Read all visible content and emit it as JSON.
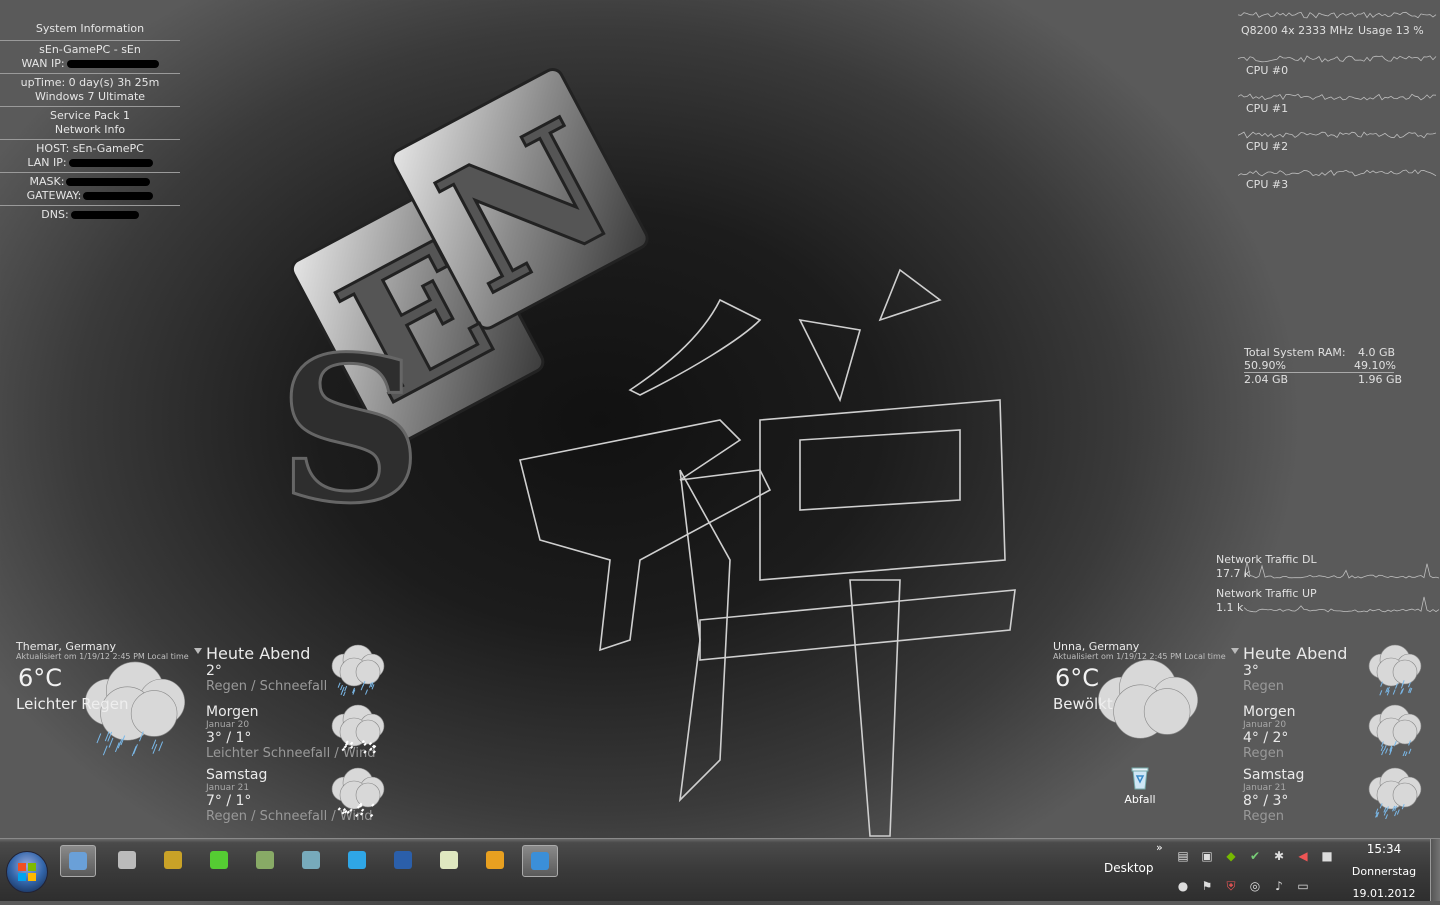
{
  "sysinfo": {
    "title": "System Information",
    "computer": "sEn-GamePC - sEn",
    "wan_label": "WAN IP:",
    "uptime": "upTime: 0 day(s) 3h 25m",
    "os": "Windows 7 Ultimate",
    "sp": "Service Pack 1",
    "netinfo": "Network Info",
    "host": "HOST: sEn-GamePC",
    "lan_label": "LAN IP:",
    "mask_label": "MASK:",
    "gateway_label": "GATEWAY:",
    "dns_label": "DNS:"
  },
  "cpu": {
    "model": "Q8200 4x 2333 MHz",
    "usage": "Usage 13 %",
    "cores": [
      "CPU #0",
      "CPU #1",
      "CPU #2",
      "CPU #3"
    ]
  },
  "ram": {
    "label": "Total System RAM:",
    "total": "4.0 GB",
    "used_pct": "50.90%",
    "free_pct": "49.10%",
    "used": "2.04 GB",
    "free": "1.96 GB"
  },
  "net": {
    "dl_label": "Network Traffic DL",
    "dl_value": "17.7 k",
    "up_label": "Network Traffic UP",
    "up_value": "1.1 k"
  },
  "weather_left": {
    "location": "Themar, Germany",
    "updated": "Aktualisiert om 1/19/12 2:45 PM Local time",
    "temp": "6°C",
    "condition": "Leichter Regen",
    "forecast": [
      {
        "day": "Heute Abend",
        "sub": "",
        "temp": "2°",
        "cond": "Regen / Schneefall"
      },
      {
        "day": "Morgen",
        "sub": "Januar 20",
        "temp": "3° / 1°",
        "cond": "Leichter Schneefall / Wind"
      },
      {
        "day": "Samstag",
        "sub": "Januar 21",
        "temp": "7° / 1°",
        "cond": "Regen / Schneefall / Wind"
      }
    ]
  },
  "weather_right": {
    "location": "Unna, Germany",
    "updated": "Aktualisiert om 1/19/12 2:45 PM Local time",
    "temp": "6°C",
    "condition": "Bewölkt",
    "forecast": [
      {
        "day": "Heute Abend",
        "sub": "",
        "temp": "3°",
        "cond": "Regen"
      },
      {
        "day": "Morgen",
        "sub": "Januar 20",
        "temp": "4° / 2°",
        "cond": "Regen"
      },
      {
        "day": "Samstag",
        "sub": "Januar 21",
        "temp": "8° / 3°",
        "cond": "Regen"
      }
    ]
  },
  "desktop": {
    "recycle_label": "Abfall"
  },
  "taskbar": {
    "desktop_label": "Desktop",
    "time": "15:34",
    "day": "Donnerstag",
    "date": "19.01.2012",
    "apps": [
      {
        "name": "gadget-app",
        "color": "#6aa0d8"
      },
      {
        "name": "steam-app",
        "color": "#bbbbbb"
      },
      {
        "name": "lol-app",
        "color": "#c9a227"
      },
      {
        "name": "icq-app",
        "color": "#55cc33"
      },
      {
        "name": "game-app",
        "color": "#88aa66"
      },
      {
        "name": "teamspeak-app",
        "color": "#7ab"
      },
      {
        "name": "skype-app",
        "color": "#2fa6e6"
      },
      {
        "name": "photoshop-app",
        "color": "#2b5faa"
      },
      {
        "name": "notepad-app",
        "color": "#dfe8c0"
      },
      {
        "name": "mediaplayer-app",
        "color": "#e8a020"
      },
      {
        "name": "ie-app",
        "color": "#3b8fd8"
      }
    ]
  }
}
